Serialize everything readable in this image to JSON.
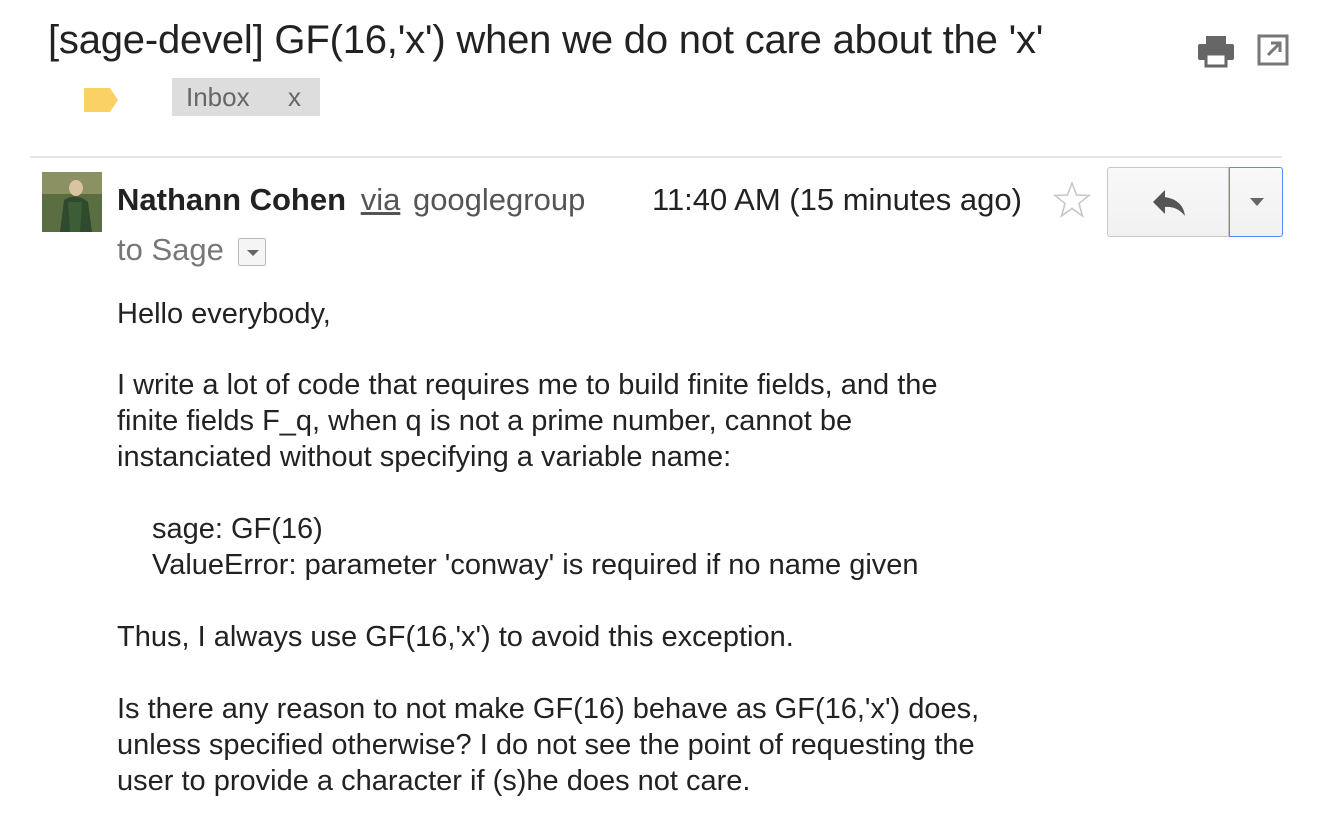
{
  "subject": "[sage-devel] GF(16,'x') when we do not care about the 'x'",
  "toolbar": {
    "print_icon": "print-icon",
    "popout_icon": "new-window-icon"
  },
  "labels": {
    "tag_icon": "label-icon",
    "tag_color": "#fad165",
    "inbox": "Inbox",
    "remove": "x"
  },
  "message": {
    "sender_name": "Nathann Cohen",
    "via": "via",
    "group": "googlegroup",
    "time": "11:40 AM (15 minutes ago)",
    "to": "to Sage",
    "reply_icon": "reply-icon",
    "more_icon": "dropdown-arrow-icon",
    "star_icon": "star-icon"
  },
  "body": {
    "greeting": "Hello everybody,",
    "para1": [
      "I write a lot of code that requires me to build finite fields, and the",
      "finite fields F_q, when q is not a prime number, cannot be",
      "instanciated without specifying a variable name:"
    ],
    "code": [
      "sage: GF(16)",
      "ValueError: parameter 'conway' is required if no name given"
    ],
    "para2": "Thus, I always use GF(16,'x') to avoid this exception.",
    "para3": [
      "Is there any reason to not make GF(16) behave as GF(16,'x') does,",
      "unless specified otherwise? I do not see the point of requesting the",
      "user to provide a character if (s)he does not care."
    ]
  }
}
